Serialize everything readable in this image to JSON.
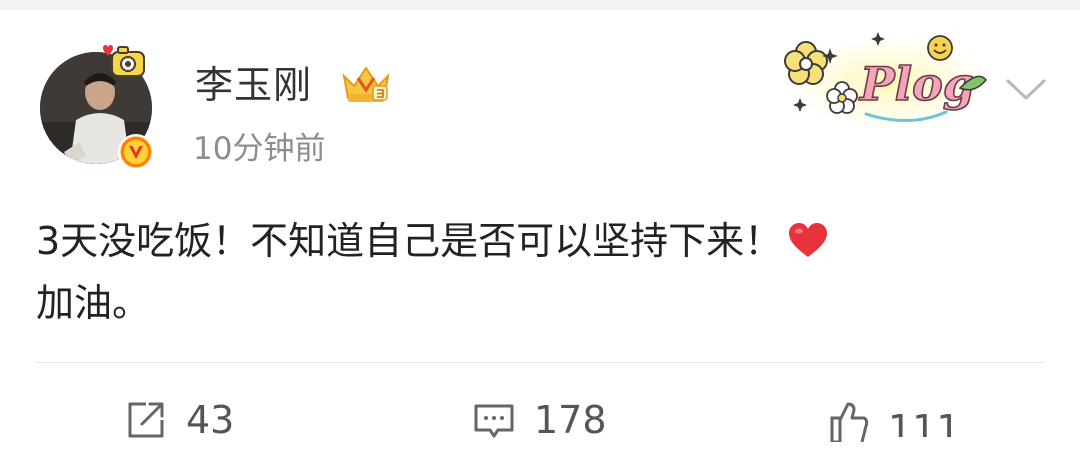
{
  "post": {
    "author": {
      "name": "李玉刚"
    },
    "time": "10分钟前",
    "text_line1": "3天没吃饭！不知道自己是否可以坚持下来！",
    "text_line2": "加油。"
  },
  "actions": {
    "repost_count": "43",
    "comment_count": "178",
    "like_count": "111"
  },
  "sticker": {
    "text": "Plog"
  },
  "colors": {
    "text_primary": "#222222",
    "username": "#333333",
    "meta": "#8d8d8d",
    "verify_orange": "#ff8200",
    "heart_red": "#e8323c"
  },
  "icons": {
    "repost": "share-external-icon",
    "comment": "comment-bubble-icon",
    "like": "thumbs-up-icon",
    "menu": "chevron-down-icon",
    "verify": "verified-v-icon",
    "vip": "vip-crown-badge-icon",
    "heart": "red-heart-emoji-icon"
  }
}
